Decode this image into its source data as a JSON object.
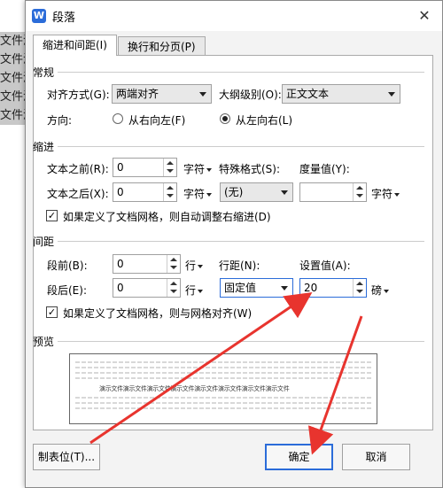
{
  "background_doc": {
    "lines": [
      "文件演",
      "文件演",
      "文件演",
      "文件演",
      "文件演"
    ]
  },
  "dialog": {
    "title": "段落",
    "tabs": [
      {
        "label": "缩进和间距(I)"
      },
      {
        "label": "换行和分页(P)"
      }
    ],
    "general": {
      "section": "常规",
      "alignment_label": "对齐方式(G):",
      "alignment_value": "两端对齐",
      "outline_label": "大纲级别(O):",
      "outline_value": "正文文本",
      "direction_label": "方向:",
      "rtl_label": "从右向左(F)",
      "ltr_label": "从左向右(L)"
    },
    "indent": {
      "section": "缩进",
      "before_label": "文本之前(R):",
      "before_value": "0",
      "before_unit": "字符",
      "after_label": "文本之后(X):",
      "after_value": "0",
      "after_unit": "字符",
      "special_label": "特殊格式(S):",
      "special_value": "(无)",
      "measure_label": "度量值(Y):",
      "measure_value": "",
      "measure_unit": "字符",
      "grid_check_label": "如果定义了文档网格，则自动调整右缩进(D)"
    },
    "spacing": {
      "section": "间距",
      "before_label": "段前(B):",
      "before_value": "0",
      "before_unit": "行",
      "after_label": "段后(E):",
      "after_value": "0",
      "after_unit": "行",
      "line_label": "行距(N):",
      "line_value": "固定值",
      "setting_label": "设置值(A):",
      "setting_value": "20",
      "setting_unit": "磅",
      "grid_check_label": "如果定义了文档网格，则与网格对齐(W)"
    },
    "preview": {
      "section": "预览",
      "sample_text": "演示文件演示文件演示文件演示文件演示文件演示文件演示文件演示文件"
    },
    "buttons": {
      "tabs": "制表位(T)...",
      "ok": "确定",
      "cancel": "取消"
    }
  },
  "colors": {
    "accent": "#2b6cd9",
    "annotation": "#e8342e"
  }
}
